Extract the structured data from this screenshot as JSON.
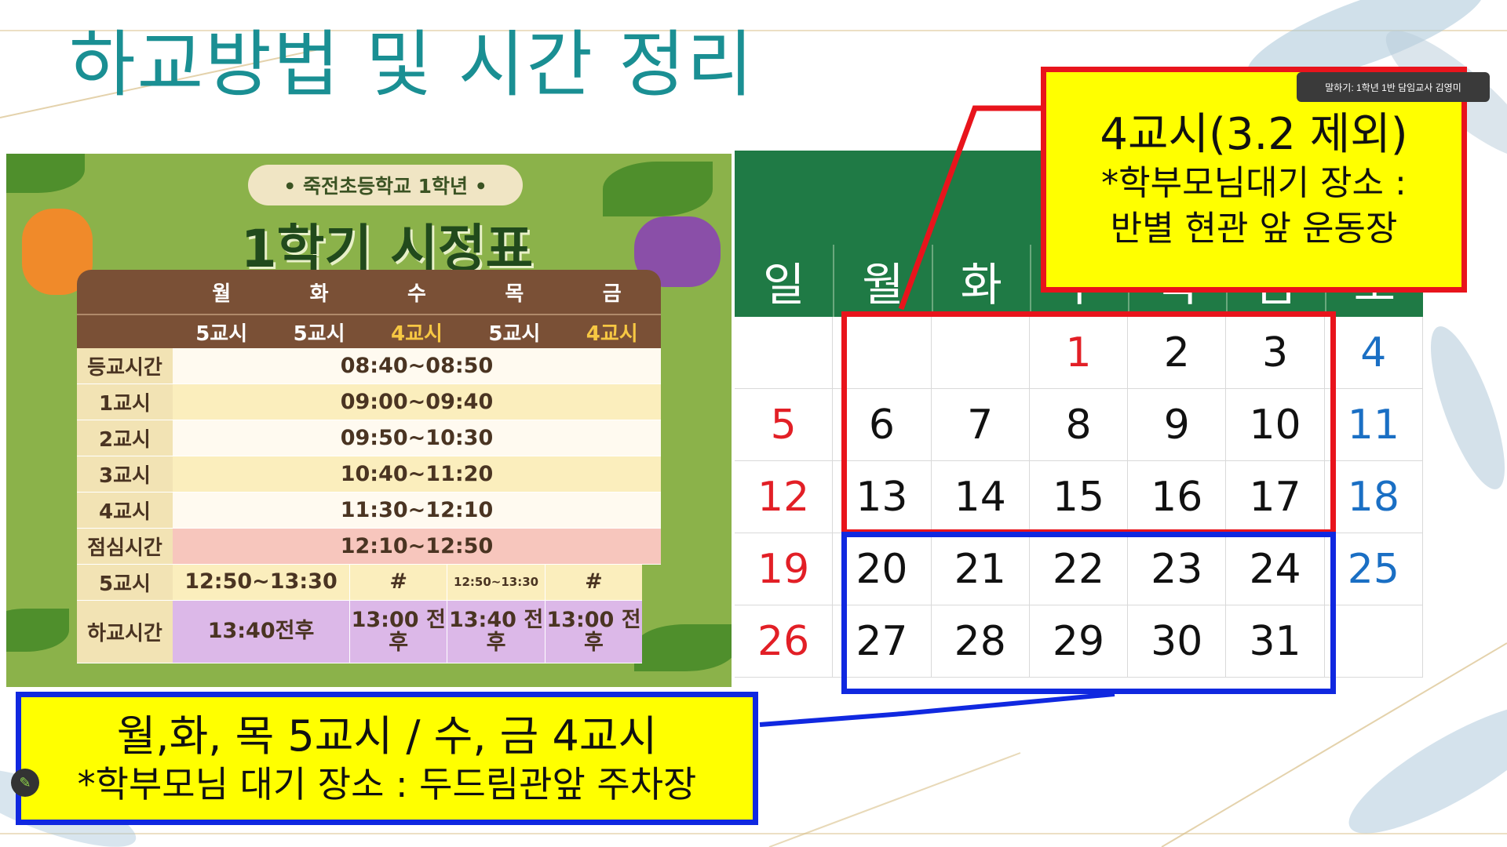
{
  "slide": {
    "title": "하교방법 및 시간 정리"
  },
  "status": {
    "speaking": "말하기: 1학년 1반 담임교사 김영미"
  },
  "poster": {
    "pill": "• 죽전초등학교 1학년 •",
    "title": "1학기 시정표",
    "header_days": [
      "월",
      "화",
      "수",
      "목",
      "금"
    ],
    "header_periods": [
      "5교시",
      "5교시",
      "4교시",
      "5교시",
      "4교시"
    ],
    "rows": [
      {
        "label": "등교시간",
        "value": "08:40~08:50"
      },
      {
        "label": "1교시",
        "value": "09:00~09:40"
      },
      {
        "label": "2교시",
        "value": "09:50~10:30"
      },
      {
        "label": "3교시",
        "value": "10:40~11:20"
      },
      {
        "label": "4교시",
        "value": "11:30~12:10"
      },
      {
        "label": "점심시간",
        "value": "12:10~12:50"
      }
    ],
    "period5": {
      "label": "5교시",
      "mon_tue": "12:50~13:30",
      "wed": "#",
      "thu": "12:50~13:30",
      "fri": "#"
    },
    "dismissal": {
      "label": "하교시간",
      "mon_tue": "13:40전후",
      "wed": "13:00 전후",
      "thu": "13:40 전후",
      "fri": "13:00 전후"
    }
  },
  "calendar": {
    "weekdays": [
      "일",
      "월",
      "화",
      "수",
      "목",
      "금",
      "토"
    ],
    "weeks": [
      [
        "",
        "",
        "",
        "1",
        "2",
        "3",
        "4"
      ],
      [
        "5",
        "6",
        "7",
        "8",
        "9",
        "10",
        "11"
      ],
      [
        "12",
        "13",
        "14",
        "15",
        "16",
        "17",
        "18"
      ],
      [
        "19",
        "20",
        "21",
        "22",
        "23",
        "24",
        "25"
      ],
      [
        "26",
        "27",
        "28",
        "29",
        "30",
        "31",
        ""
      ]
    ]
  },
  "note_top": {
    "line1": "4교시(3.2 제외)",
    "line2": "*학부모님대기 장소 :",
    "line3": "반별 현관 앞 운동장"
  },
  "note_bottom": {
    "line1": "월,화, 목 5교시 / 수, 금 4교시",
    "line2": "*학부모님  대기 장소 : 두드림관앞 주차장"
  },
  "colors": {
    "title": "#1a8f93",
    "highlight_red": "#e8141c",
    "highlight_blue": "#1028e0",
    "note_fill": "#ffff00",
    "calendar_header": "#1f7a45"
  }
}
